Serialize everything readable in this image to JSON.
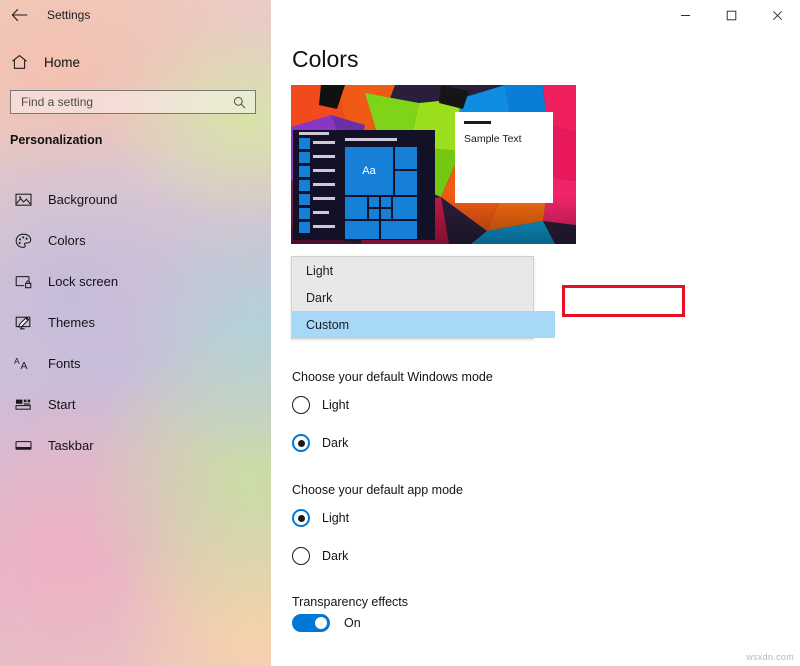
{
  "titlebar": {
    "back_icon": "back-arrow-icon",
    "title": "Settings",
    "minimize": "–",
    "maximize": "□",
    "close": "✕"
  },
  "sidebar": {
    "home": {
      "label": "Home",
      "icon": "home-icon"
    },
    "search": {
      "placeholder": "Find a setting",
      "value": "",
      "icon": "search-icon"
    },
    "section_header": "Personalization",
    "items": [
      {
        "label": "Background",
        "icon": "image-icon"
      },
      {
        "label": "Colors",
        "icon": "palette-icon"
      },
      {
        "label": "Lock screen",
        "icon": "lock-screen-icon"
      },
      {
        "label": "Themes",
        "icon": "themes-brush-icon"
      },
      {
        "label": "Fonts",
        "icon": "fonts-aa-icon"
      },
      {
        "label": "Start",
        "icon": "start-tiles-icon"
      },
      {
        "label": "Taskbar",
        "icon": "taskbar-icon"
      }
    ]
  },
  "main": {
    "page_title": "Colors",
    "preview": {
      "sample_window_text": "Sample Text",
      "tile_text": "Aa"
    },
    "dropdown": {
      "options": [
        {
          "label": "Light",
          "state": "normal"
        },
        {
          "label": "Dark",
          "state": "annotated"
        },
        {
          "label": "Custom",
          "state": "selected"
        }
      ]
    },
    "windows_mode": {
      "label": "Choose your default Windows mode",
      "options": [
        {
          "label": "Light",
          "checked": false
        },
        {
          "label": "Dark",
          "checked": true
        }
      ]
    },
    "app_mode": {
      "label": "Choose your default app mode",
      "options": [
        {
          "label": "Light",
          "checked": true
        },
        {
          "label": "Dark",
          "checked": false
        }
      ]
    },
    "transparency": {
      "label": "Transparency effects",
      "state_label": "On",
      "on": true
    }
  },
  "watermark": "wsxdn.com",
  "colors": {
    "accent_blue": "#0078d7",
    "selection_blue": "#a8d8f8",
    "annotation_red": "#e81123",
    "tile_blue": "#1680d8"
  }
}
